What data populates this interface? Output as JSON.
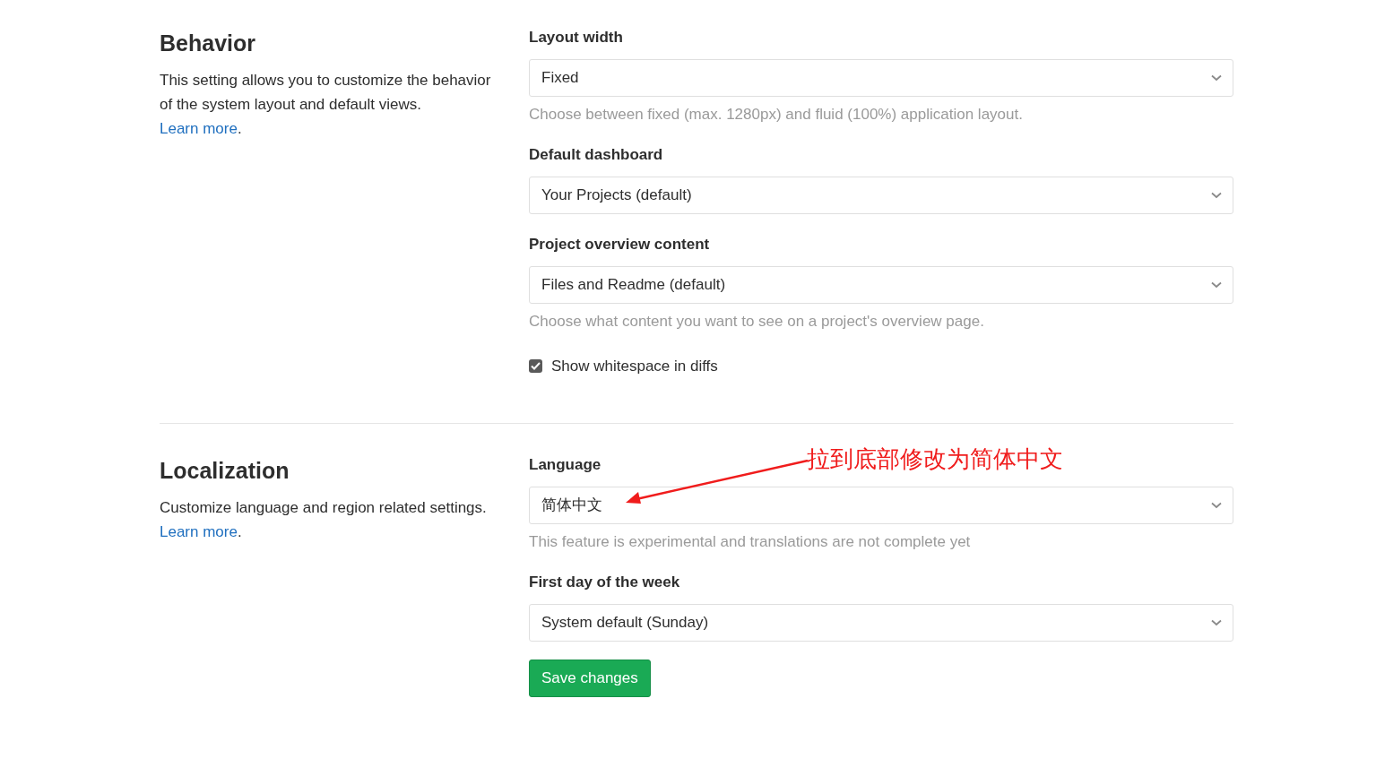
{
  "sections": [
    {
      "title": "Behavior",
      "description": "This setting allows you to customize the behavior of the system layout and default views.",
      "link": "Learn more",
      "link_suffix": ".",
      "fields": [
        {
          "kind": "select",
          "label": "Layout width",
          "value": "Fixed",
          "help": "Choose between fixed (max. 1280px) and fluid (100%) application layout."
        },
        {
          "kind": "select",
          "label": "Default dashboard",
          "value": "Your Projects (default)"
        },
        {
          "kind": "select",
          "label": "Project overview content",
          "value": "Files and Readme (default)",
          "help": "Choose what content you want to see on a project's overview page."
        },
        {
          "kind": "checkbox",
          "label": "Show whitespace in diffs",
          "checked": true
        }
      ]
    },
    {
      "title": "Localization",
      "description": "Customize language and region related settings.",
      "link": "Learn more",
      "link_suffix": ".",
      "fields": [
        {
          "kind": "select",
          "label": "Language",
          "value": "简体中文",
          "help": "This feature is experimental and translations are not complete yet",
          "annotation": "拉到底部修改为简体中文"
        },
        {
          "kind": "select",
          "label": "First day of the week",
          "value": "System default (Sunday)"
        }
      ]
    }
  ],
  "save_button": "Save changes"
}
